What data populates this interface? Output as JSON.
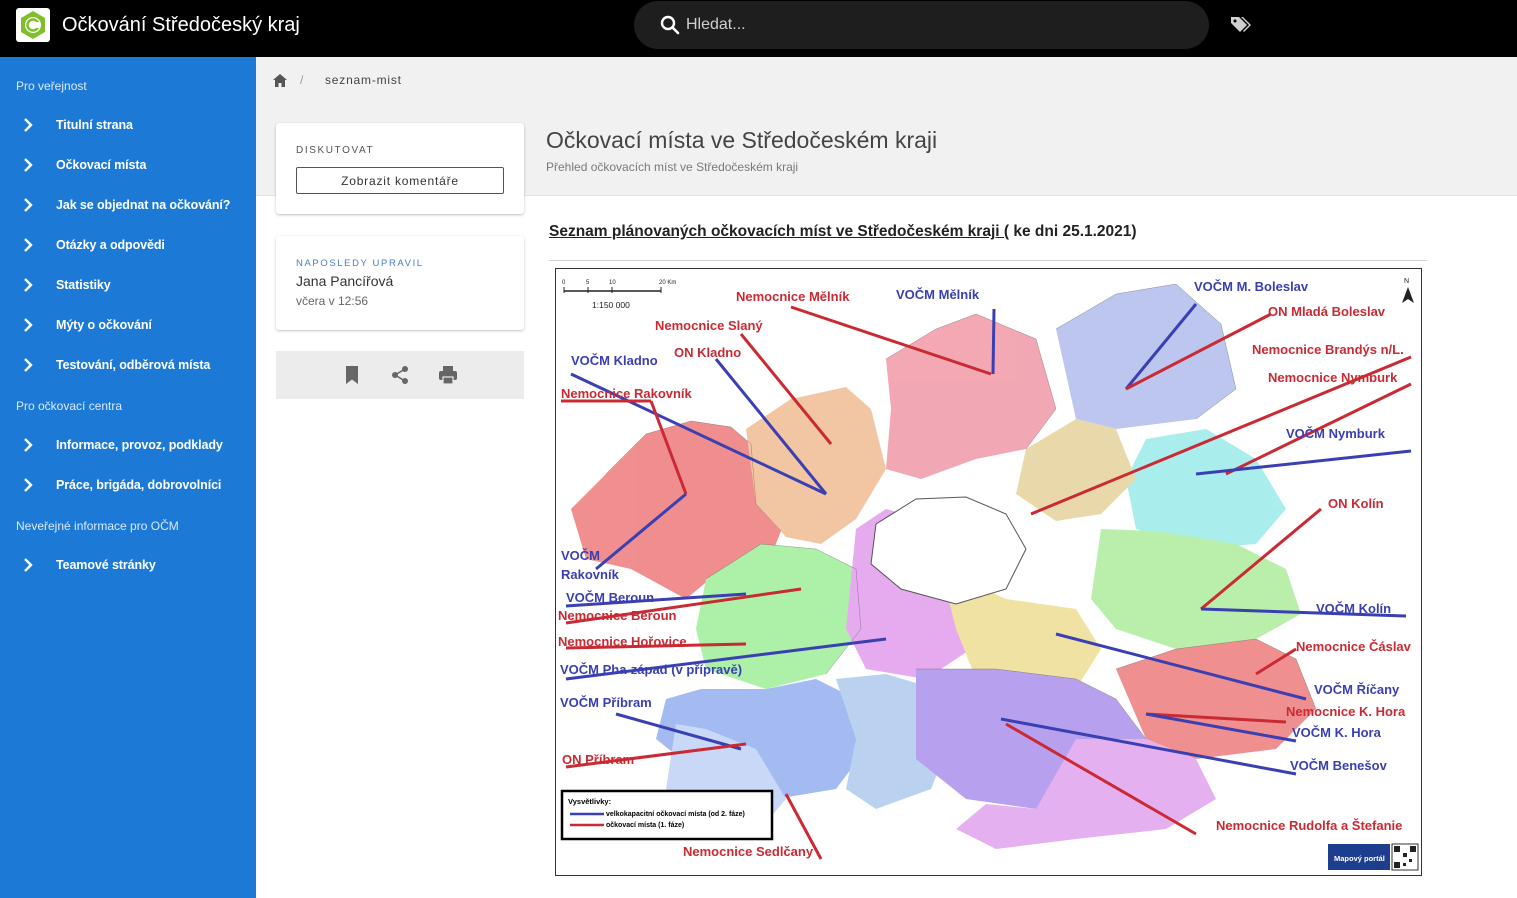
{
  "header": {
    "site_title": "Očkování Středočeský kraj",
    "search_placeholder": "Hledat..."
  },
  "sidebar": {
    "sections": [
      {
        "title": "Pro veřejnost"
      },
      {
        "title": "Pro očkovací centra"
      },
      {
        "title": "Neveřejné informace pro OČM"
      }
    ],
    "items": [
      {
        "label": "Titulní strana"
      },
      {
        "label": "Očkovací místa"
      },
      {
        "label": "Jak se objednat na očkování?"
      },
      {
        "label": "Otázky a odpovědi"
      },
      {
        "label": "Statistiky"
      },
      {
        "label": "Mýty o očkování"
      },
      {
        "label": "Testování, odběrová místa"
      },
      {
        "label": "Informace, provoz, podklady"
      },
      {
        "label": "Práce, brigáda, dobrovolníci"
      },
      {
        "label": "Teamové stránky"
      }
    ]
  },
  "breadcrumb": {
    "separator": "/",
    "current": "seznam-mist"
  },
  "page": {
    "title": "Očkovací místa ve Středočeském kraji",
    "subtitle": "Přehled očkovacích míst ve Středočeském kraji"
  },
  "discuss_card": {
    "caption": "DISKUTOVAT",
    "button_label": "Zobrazit komentáře"
  },
  "edit_card": {
    "caption": "NAPOSLEDY UPRAVIL",
    "author": "Jana Pancířová",
    "when": "včera v 12:56"
  },
  "content": {
    "heading_underlined": "Seznam plánovaných očkovacích míst ve Středočeském kraji (",
    "heading_rest": " ke dni 25.1.2021)"
  },
  "map": {
    "scale_labels": [
      "0",
      "5",
      "10",
      "20 Km"
    ],
    "scale_ratio": "1:150 000",
    "north": "N",
    "legend_title": "Vysvětlivky:",
    "legend_blue": "velkokapacitní očkovací místa (od 2. fáze)",
    "legend_red": "očkovací místa (1. fáze)",
    "portal_label": "Mapový portál",
    "colors": {
      "red": "#c92a33",
      "blue": "#3a3fb1"
    },
    "labels": {
      "nem_melnik": "Nemocnice Mělník",
      "vocm_melnik": "VOČM Mělník",
      "vocm_mboleslav": "VOČM M. Boleslav",
      "on_mlada": "ON Mladá Boleslav",
      "nem_slany": "Nemocnice Slaný",
      "vocm_kladno": "VOČM Kladno",
      "on_kladno": "ON Kladno",
      "nem_brandys": "Nemocnice Brandýs n/L.",
      "nem_nymburk": "Nemocnice Nymburk",
      "nem_rakovnik": "Nemocnice Rakovník",
      "vocm_nymburk": "VOČM Nymburk",
      "on_kolin": "ON Kolín",
      "vocm_rak_1": "VOČM",
      "vocm_rak_2": "Rakovník",
      "vocm_beroun": "VOČM Beroun",
      "nem_beroun": "Nemocnice Beroun",
      "vocm_kolin": "VOČM Kolín",
      "nem_horovice": "Nemocnice Hořovice",
      "nem_caslav": "Nemocnice Čáslav",
      "vocm_phazapad": "VOČM Pha-západ (v přípravě)",
      "vocm_ricany": "VOČM Říčany",
      "vocm_pribram": "VOČM Příbram",
      "nem_khora": "Nemocnice K. Hora",
      "vocm_khora": "VOČM K. Hora",
      "on_pribram": "ON Příbram",
      "vocm_benesov": "VOČM Benešov",
      "nem_rudolfa": "Nemocnice Rudolfa a Štefanie",
      "nem_sedlcany": "Nemocnice Sedlčany"
    }
  }
}
